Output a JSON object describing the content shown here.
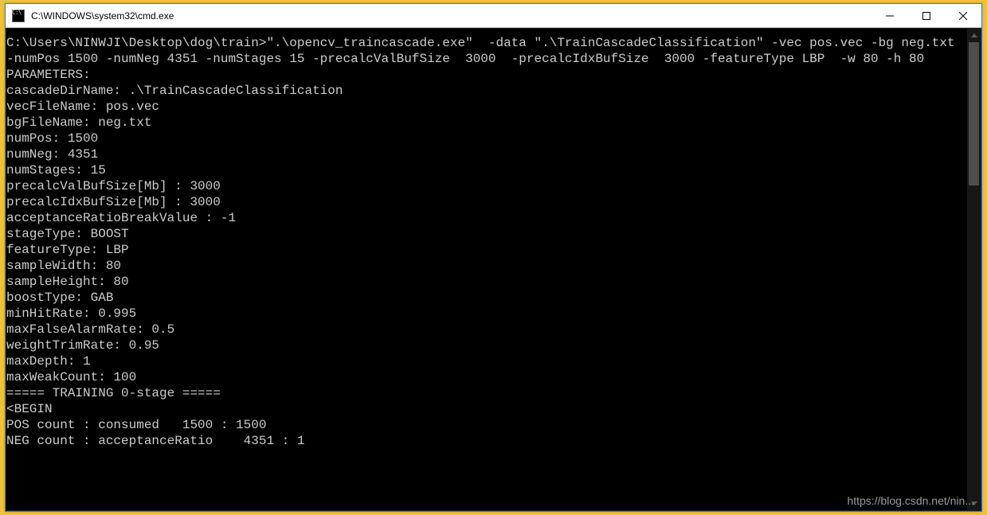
{
  "window": {
    "title": "C:\\WINDOWS\\system32\\cmd.exe"
  },
  "terminal": {
    "prompt": "C:\\Users\\NINWJI\\Desktop\\dog\\train>",
    "command": "\".\\opencv_traincascade.exe\"  -data \".\\TrainCascadeClassification\" -vec pos.vec -bg neg.txt -numPos 1500 -numNeg 4351 -numStages 15 -precalcValBufSize  3000  -precalcIdxBufSize  3000 -featureType LBP  -w 80 -h 80",
    "params_header": "PARAMETERS:",
    "params": {
      "cascadeDirName": "cascadeDirName: .\\TrainCascadeClassification",
      "vecFileName": "vecFileName: pos.vec",
      "bgFileName": "bgFileName: neg.txt",
      "numPos": "numPos: 1500",
      "numNeg": "numNeg: 4351",
      "numStages": "numStages: 15",
      "precalcValBufSize": "precalcValBufSize[Mb] : 3000",
      "precalcIdxBufSize": "precalcIdxBufSize[Mb] : 3000",
      "acceptanceRatioBreakValue": "acceptanceRatioBreakValue : -1",
      "stageType": "stageType: BOOST",
      "featureType": "featureType: LBP",
      "sampleWidth": "sampleWidth: 80",
      "sampleHeight": "sampleHeight: 80",
      "boostType": "boostType: GAB",
      "minHitRate": "minHitRate: 0.995",
      "maxFalseAlarmRate": "maxFalseAlarmRate: 0.5",
      "weightTrimRate": "weightTrimRate: 0.95",
      "maxDepth": "maxDepth: 1",
      "maxWeakCount": "maxWeakCount: 100"
    },
    "blank": "",
    "stage_header": "===== TRAINING 0-stage =====",
    "begin": "<BEGIN",
    "pos_count": "POS count : consumed   1500 : 1500",
    "neg_count": "NEG count : acceptanceRatio    4351 : 1"
  },
  "watermark": "https://blog.csdn.net/nin..."
}
